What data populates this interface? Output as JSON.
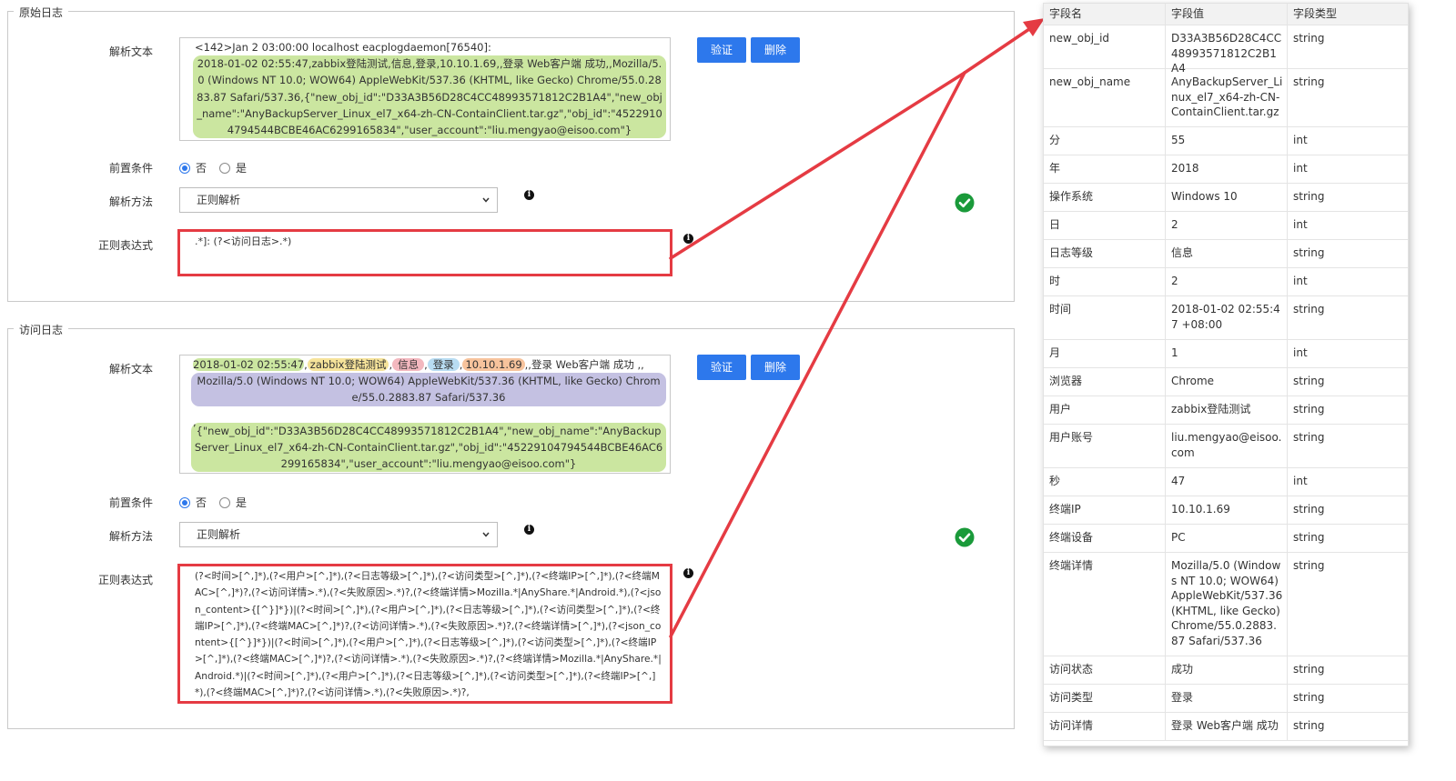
{
  "section1": {
    "legend": "原始日志",
    "parse_label": "解析文本",
    "parse_text": {
      "line1": "<142>Jan  2 03:00:00 localhost eacplogdaemon[76540]:",
      "highlighted": "2018-01-02 02:55:47,zabbix登陆测试,信息,登录,10.10.1.69,,登录 Web客户端 成功,,Mozilla/5.0 (Windows NT 10.0; WOW64) AppleWebKit/537.36 (KHTML, like Gecko) Chrome/55.0.2883.87 Safari/537.36,{\"new_obj_id\":\"D33A3B56D28C4CC48993571812C2B1A4\",\"new_obj_name\":\"AnyBackupServer_Linux_el7_x64-zh-CN-ContainClient.tar.gz\",\"obj_id\":\"45229104794544BCBE46AC6299165834\",\"user_account\":\"liu.mengyao@eisoo.com\"}"
    },
    "verify_label": "验证",
    "delete_label": "删除",
    "precondition_label": "前置条件",
    "radio_no": "否",
    "radio_yes": "是",
    "method_label": "解析方法",
    "method_value": "正则解析",
    "regex_label": "正则表达式",
    "regex_value": ".*]: (?<访问日志>.*)"
  },
  "section2": {
    "legend": "访问日志",
    "parse_label": "解析文本",
    "parse_text": {
      "time": "2018-01-02 02:55:47",
      "user": "zabbix登陆测试",
      "level": "信息",
      "type": "登录",
      "ip": "10.10.1.69",
      "detail": ",,登录 Web客户端 成功 ,,",
      "browser": "Mozilla/5.0 (Windows NT 10.0; WOW64) AppleWebKit/537.36 (KHTML, like Gecko) Chrome/55.0.2883.87 Safari/537.36",
      "sep": ",",
      "json": "{\"new_obj_id\":\"D33A3B56D28C4CC48993571812C2B1A4\",\"new_obj_name\":\"AnyBackupServer_Linux_el7_x64-zh-CN-ContainClient.tar.gz\",\"obj_id\":\"45229104794544BCBE46AC6299165834\",\"user_account\":\"liu.mengyao@eisoo.com\"}"
    },
    "verify_label": "验证",
    "delete_label": "删除",
    "precondition_label": "前置条件",
    "radio_no": "否",
    "radio_yes": "是",
    "method_label": "解析方法",
    "method_value": "正则解析",
    "regex_label": "正则表达式",
    "regex_value": "(?<时间>[^,]*),(?<用户>[^,]*),(?<日志等级>[^,]*),(?<访问类型>[^,]*),(?<终端IP>[^,]*),(?<终端MAC>[^,]*)?,(?<访问详情>.*),(?<失败原因>.*)?,(?<终端详情>Mozilla.*|AnyShare.*|Android.*),(?<json_content>{[^}]*})|(?<时间>[^,]*),(?<用户>[^,]*),(?<日志等级>[^,]*),(?<访问类型>[^,]*),(?<终端IP>[^,]*),(?<终端MAC>[^,]*)?,(?<访问详情>.*),(?<失败原因>.*)?,(?<终端详情>[^,]*),(?<json_content>{[^}]*})|(?<时间>[^,]*),(?<用户>[^,]*),(?<日志等级>[^,]*),(?<访问类型>[^,]*),(?<终端IP>[^,]*),(?<终端MAC>[^,]*)?,(?<访问详情>.*),(?<失败原因>.*)?,(?<终端详情>Mozilla.*|AnyShare.*|Android.*)|(?<时间>[^,]*),(?<用户>[^,]*),(?<日志等级>[^,]*),(?<访问类型>[^,]*),(?<终端IP>[^,]*),(?<终端MAC>[^,]*)?,(?<访问详情>.*),(?<失败原因>.*)?,"
  },
  "table": {
    "headers": [
      "字段名",
      "字段值",
      "字段类型"
    ],
    "rows": [
      [
        "new_obj_id",
        "D33A3B56D28C4CC48993571812C2B1A4",
        "string"
      ],
      [
        "new_obj_name",
        "AnyBackupServer_Linux_el7_x64-zh-CN-ContainClient.tar.gz",
        "string"
      ],
      [
        "分",
        "55",
        "int"
      ],
      [
        "年",
        "2018",
        "int"
      ],
      [
        "操作系统",
        "Windows 10",
        "string"
      ],
      [
        "日",
        "2",
        "int"
      ],
      [
        "日志等级",
        "信息",
        "string"
      ],
      [
        "时",
        "2",
        "int"
      ],
      [
        "时间",
        "2018-01-02 02:55:47 +08:00",
        "string"
      ],
      [
        "月",
        "1",
        "int"
      ],
      [
        "浏览器",
        "Chrome",
        "string"
      ],
      [
        "用户",
        "zabbix登陆测试",
        "string"
      ],
      [
        "用户账号",
        "liu.mengyao@eisoo.com",
        "string"
      ],
      [
        "秒",
        "47",
        "int"
      ],
      [
        "终端IP",
        "10.10.1.69",
        "string"
      ],
      [
        "终端设备",
        "PC",
        "string"
      ],
      [
        "终端详情",
        "Mozilla/5.0 (Windows NT 10.0; WOW64) AppleWebKit/537.36 (KHTML, like Gecko) Chrome/55.0.2883.87 Safari/537.36",
        "string"
      ],
      [
        "访问状态",
        "成功",
        "string"
      ],
      [
        "访问类型",
        "登录",
        "string"
      ],
      [
        "访问详情",
        "登录 Web客户端 成功",
        "string"
      ]
    ]
  },
  "colors": {
    "accent_button": "#2d78ec",
    "annotation_red": "#e53b43",
    "success_green": "#1a9a3a"
  },
  "icons": {
    "info": "info-icon",
    "success": "check-circle-icon",
    "dropdown": "chevron-down-icon"
  }
}
